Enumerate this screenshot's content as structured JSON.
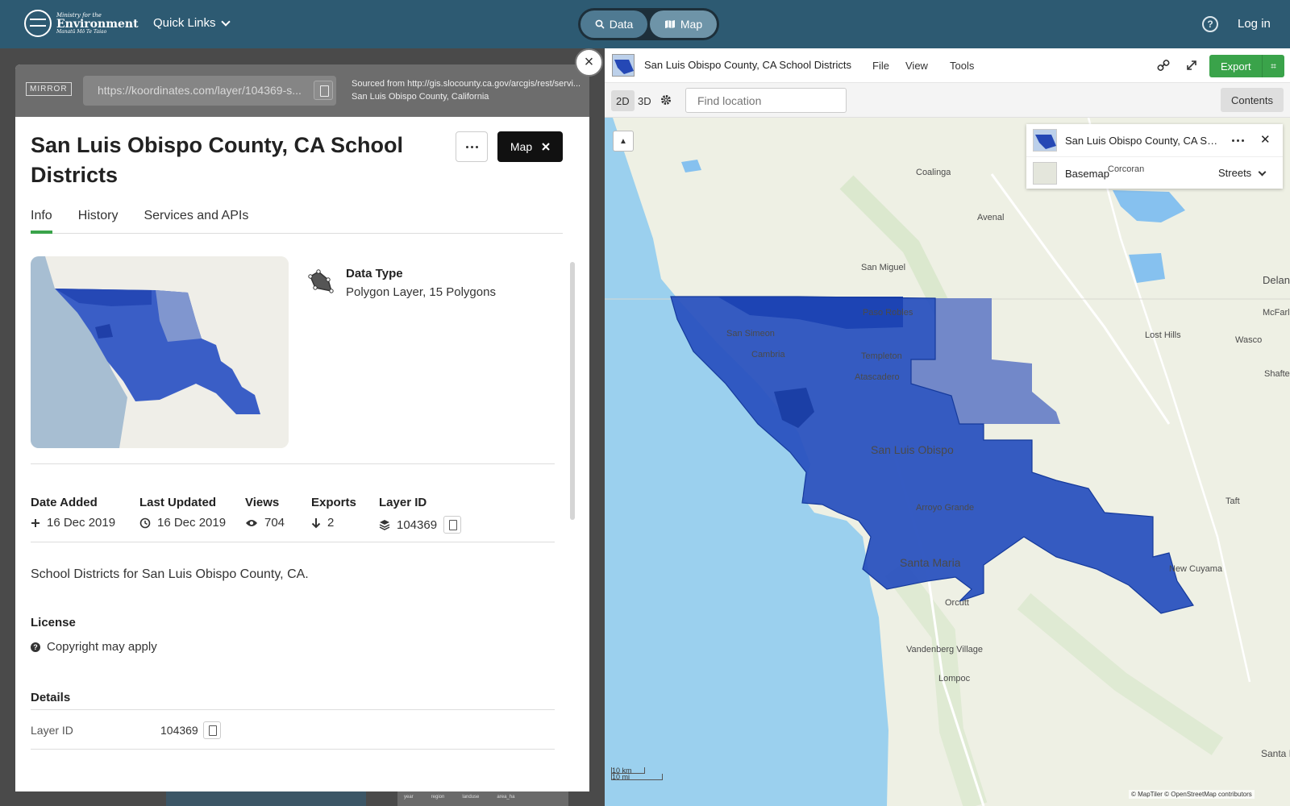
{
  "topnav": {
    "logo": {
      "line1": "Ministry for the",
      "line2": "Environment",
      "line3": "Manatū Mō Te Taiao"
    },
    "quick_links": "Quick Links",
    "toggle": {
      "data": "Data",
      "map": "Map"
    },
    "login": "Log in",
    "help_glyph": "?"
  },
  "panel": {
    "mirror": "MIRROR",
    "url": "https://koordinates.com/layer/104369-s...",
    "sourced_line1": "Sourced from http://gis.slocounty.ca.gov/arcgis/rest/servi...",
    "sourced_line2": "San Luis Obispo County, California",
    "title": "San Luis Obispo County, CA School Districts",
    "map_button": "Map",
    "tabs": [
      "Info",
      "History",
      "Services and APIs"
    ],
    "data_type_label": "Data Type",
    "data_type_value": "Polygon Layer, 15 Polygons",
    "stats": {
      "date_added_label": "Date Added",
      "date_added": "16 Dec 2019",
      "last_updated_label": "Last Updated",
      "last_updated": "16 Dec 2019",
      "views_label": "Views",
      "views": "704",
      "exports_label": "Exports",
      "exports": "2",
      "layer_id_label": "Layer ID",
      "layer_id": "104369"
    },
    "description": "School Districts for San Luis Obispo County, CA.",
    "license_heading": "License",
    "license_value": "Copyright may apply",
    "details_heading": "Details",
    "details": [
      {
        "label": "Layer ID",
        "value": "104369"
      }
    ],
    "background_table_headers": [
      "year",
      "region",
      "landuse",
      "area_ha"
    ]
  },
  "map": {
    "title": "San Luis Obispo County, CA School Districts",
    "menu": [
      "File",
      "View",
      "Tools"
    ],
    "export": "Export",
    "mode_2d": "2D",
    "mode_3d": "3D",
    "find_placeholder": "Find location",
    "contents": "Contents",
    "layers": [
      {
        "name": "San Luis Obispo County, CA School Districts"
      },
      {
        "name": "Basemap",
        "style": "Streets"
      }
    ],
    "places": [
      "Coalinga",
      "Avenal",
      "Corcoran",
      "San Miguel",
      "Paso Robles",
      "San Simeon",
      "Cambria",
      "Templeton",
      "Atascadero",
      "Lost Hills",
      "Wasco",
      "Shafter",
      "Delano",
      "McFarland",
      "San Luis Obispo",
      "Arroyo Grande",
      "Santa Maria",
      "Orcutt",
      "Taft",
      "New Cuyama",
      "Vandenberg Village",
      "Lompoc",
      "Santa Barbara"
    ],
    "scale_km": "10 km",
    "scale_mi": "10 mi",
    "attribution": "© MapTiler © OpenStreetMap contributors"
  },
  "colors": {
    "nav": "#2d5a72",
    "accent_green": "#3aa34a",
    "district_fill": "#1f48b8",
    "district_light": "#6d83c4",
    "water": "#9bd0ee",
    "land": "#eef0e4"
  },
  "icons": [
    "search-icon",
    "map-icon",
    "help-icon",
    "copy-icon",
    "close-icon",
    "polygon-icon",
    "plus-icon",
    "history-icon",
    "eye-icon",
    "download-icon",
    "layers-icon",
    "question-icon",
    "link-icon",
    "expand-icon",
    "gear-icon",
    "compass-icon"
  ]
}
